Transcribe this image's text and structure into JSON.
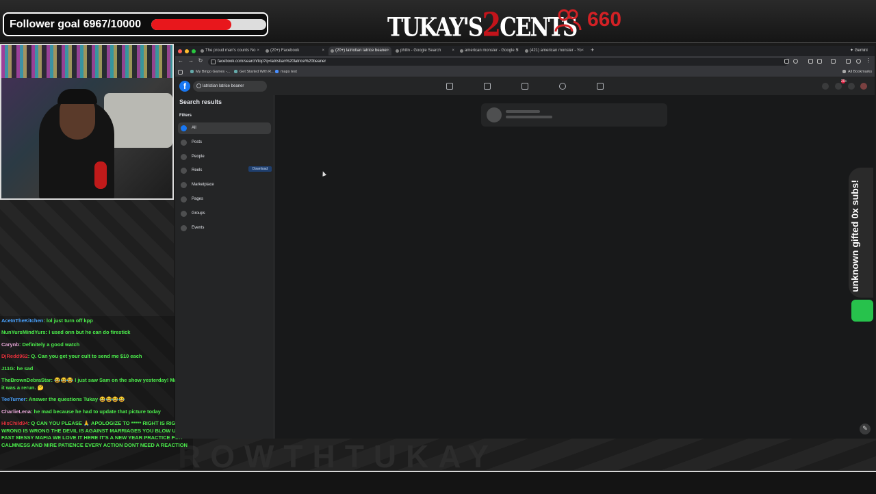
{
  "overlay": {
    "follower_goal": "Follower goal 6967/10000",
    "follower_progress": 0.6967,
    "logo_left": "TUKAY'S",
    "logo_num": "2",
    "logo_right": "CENTS",
    "viewer_count": "660",
    "subs_banner": "unknown gifted 0x subs!",
    "bottom_watermark": "ROWTHTUKAY",
    "accent_color": "#e8171c"
  },
  "chat": [
    {
      "user": "AceInTheKitchen",
      "color": "#4aa3ff",
      "text": "lol just turn off kpp"
    },
    {
      "user": "NunYursMindYurs",
      "color": "#4cf04c",
      "text": "I used onn but he can do firestick"
    },
    {
      "user": "Carynb",
      "color": "#e8a8d8",
      "text": "Definitely a good watch"
    },
    {
      "user": "DjRedd962",
      "color": "#e0303a",
      "text": "Q. Can you get your cult to send me $10 each"
    },
    {
      "user": "J11G",
      "color": "#4cf04c",
      "text": "he sad"
    },
    {
      "user": "TheBrownDebraStar",
      "color": "#4cf04c",
      "text": "😂😂😂 I just saw Sam on the show yesterday! Maybe it was a rerun. 🤔"
    },
    {
      "user": "TeeTurner",
      "color": "#4aa3ff",
      "text": "Answer the questions Tukay 😂😂😂😂"
    },
    {
      "user": "CharlieLena",
      "color": "#e8a8d8",
      "text": "he mad because he had to update that picture today"
    },
    {
      "user": "HisChild94",
      "color": "#e0303a",
      "text": "Q CAN YOU PLEASE 🙏 APOLOGIZE TO ***** RIGHT IS RIGHT WRONG IS WRONG THE DEVIL IS AGAINST MARRIAGES YOU BLOW UP FAST MESSY MAFIA WE LOVE IT HERE IT'S A NEW YEAR PRACTICE FOR CALMNESS AND MIRE PATIENCE EVERY ACTION DONT NEED A REACTION"
    }
  ],
  "browser": {
    "tabs": [
      {
        "label": "The proud man's counts No"
      },
      {
        "label": "(20+) Facebook"
      },
      {
        "label": "(20+) latriotian latrice beaner"
      },
      {
        "label": "philin - Google Search"
      },
      {
        "label": "american monster - Google S"
      },
      {
        "label": "(421) american monster - Yo"
      }
    ],
    "new_tab": "+",
    "gemini": "✦ Gemini",
    "url": "facebook.com/search/top?q=latristian%20latrice%20beaner",
    "bookmarks": [
      "My Bingo Games -...",
      "Get Started With R...",
      "maps text"
    ],
    "all_bookmarks": "All Bookmarks"
  },
  "facebook": {
    "logo": "f",
    "search_value": "latristian latrice beaner",
    "sidebar_title": "Search results",
    "filters_label": "Filters",
    "filters": [
      "All",
      "Posts",
      "People",
      "Reels",
      "Marketplace",
      "Pages",
      "Groups",
      "Events"
    ],
    "download": "Download",
    "notif_badge": "20+"
  }
}
